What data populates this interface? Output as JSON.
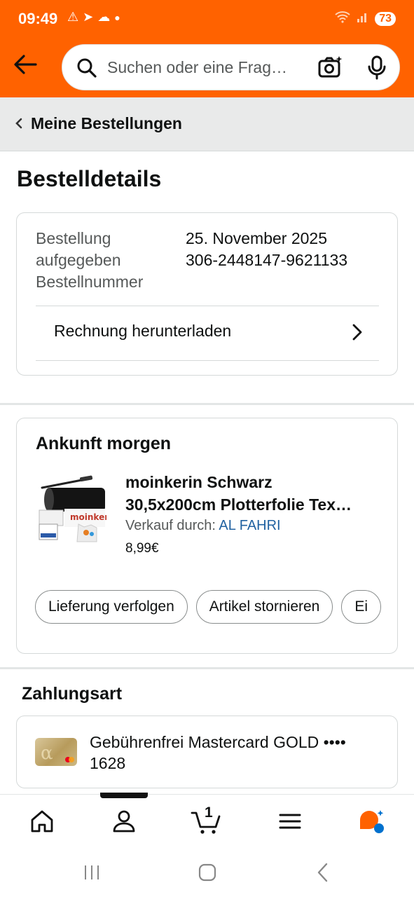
{
  "status_bar": {
    "time": "09:49",
    "battery": "73"
  },
  "header": {
    "search_placeholder": "Suchen oder eine Frag…"
  },
  "breadcrumb": {
    "label": "Meine Bestellungen"
  },
  "page": {
    "title": "Bestelldetails"
  },
  "order_info": {
    "placed_label_1": "Bestellung",
    "placed_label_2": "aufgegeben",
    "placed_value": "25. November 2025",
    "number_label": "Bestellnummer",
    "number_value": "306-2448147-9621133",
    "invoice_label": "Rechnung herunterladen"
  },
  "shipment": {
    "title": "Ankunft morgen",
    "product_title_line1": "moinkerin Schwarz",
    "product_title_line2": "30,5x200cm Plotterfolie Tex…",
    "seller_prefix": "Verkauf durch:",
    "seller_name": "AL FAHRI",
    "price": "8,99€",
    "product_brand_text": "moinkerin",
    "actions": [
      "Lieferung verfolgen",
      "Artikel stornieren",
      "Ei"
    ]
  },
  "payment": {
    "title": "Zahlungsart",
    "card_line1": "Gebührenfrei Mastercard GOLD ••••",
    "card_line2": "1628"
  },
  "bottom_nav": {
    "cart_count": "1",
    "items": [
      "home-icon",
      "account-icon",
      "cart-icon",
      "menu-icon",
      "rufus-icon"
    ]
  },
  "colors": {
    "header_bg": "#ff6200",
    "link": "#2162a1",
    "rufus_orange": "#ff6200",
    "rufus_blue": "#0071ce"
  }
}
